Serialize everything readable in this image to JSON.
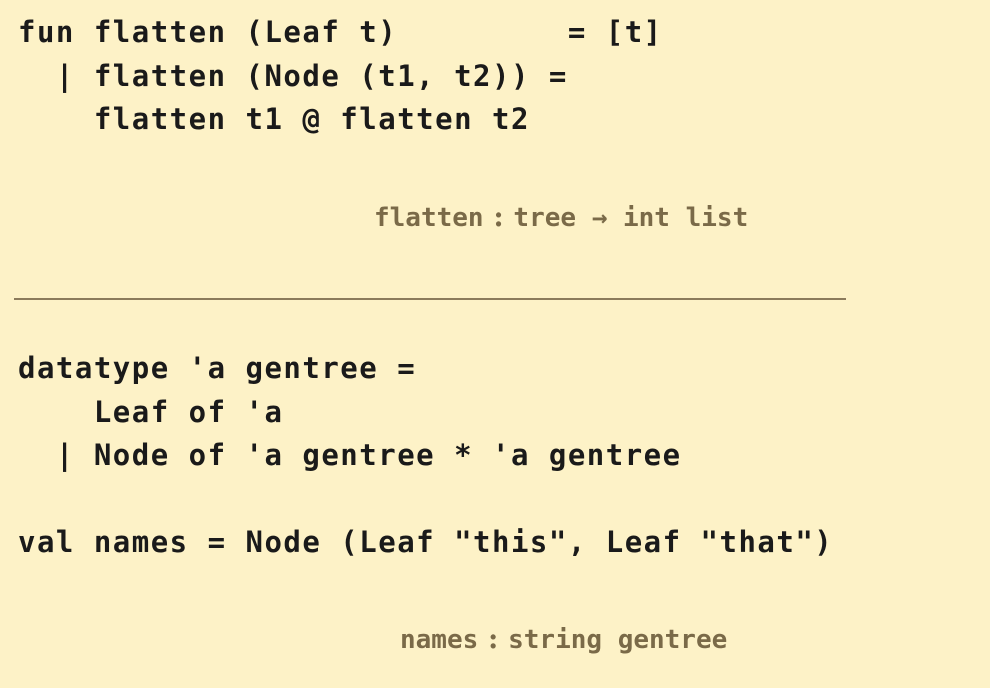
{
  "flatten_code": {
    "lines": [
      "fun flatten (Leaf t)         = [t]",
      "  | flatten (Node (t1, t2)) =",
      "    flatten t1 @ flatten t2"
    ]
  },
  "flatten_signature": {
    "name": "flatten",
    "colon": " : ",
    "type": "tree → int list"
  },
  "gentree_code": {
    "lines": [
      "datatype 'a gentree =",
      "    Leaf of 'a",
      "  | Node of 'a gentree * 'a gentree"
    ]
  },
  "names_code": {
    "lines": [
      "val names = Node (Leaf \"this\", Leaf \"that\")"
    ]
  },
  "names_signature": {
    "name": "names",
    "colon": " : ",
    "type": "string gentree"
  },
  "colors": {
    "background": "#fdf2c7",
    "code_text": "#1a1a1a",
    "signature_text": "#7a6a48",
    "divider": "#8b7b5b"
  }
}
